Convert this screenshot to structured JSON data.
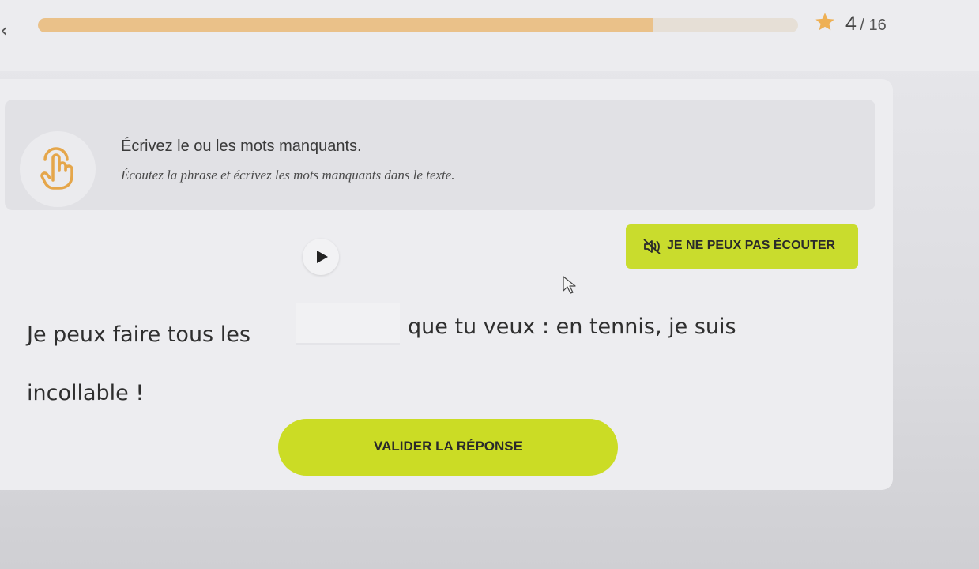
{
  "header": {
    "back_icon": "chevron-left-icon",
    "progress": 0.81,
    "progress_color": "#eac189",
    "star_icon": "star-icon",
    "star_color": "#eeb054",
    "current": "4",
    "total": "/ 16"
  },
  "instruction": {
    "icon": "hand-pointer-icon",
    "title": "Écrivez le ou les mots manquants.",
    "subtitle": "Écoutez la phrase et écrivez les mots manquants dans le texte."
  },
  "audio": {
    "play_icon": "play-icon",
    "cant_listen_icon": "speaker-muted-icon",
    "cant_listen_label": "JE NE PEUX PAS ÉCOUTER",
    "accent_color": "#c9dc2d"
  },
  "exercise": {
    "before": "Je peux faire tous les",
    "gap_value": "",
    "after_line1": "que tu veux : en tennis, je suis",
    "after_line2": "incollable !"
  },
  "actions": {
    "validate_label": "VALIDER LA RÉPONSE"
  }
}
